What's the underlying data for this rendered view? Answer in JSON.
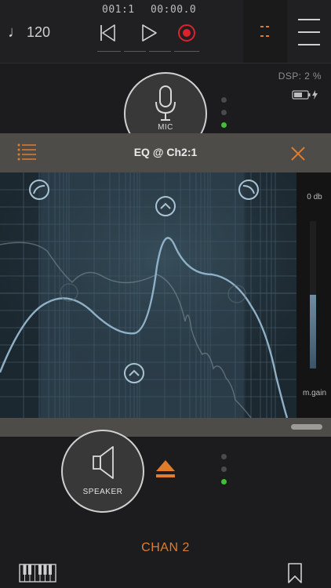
{
  "transport": {
    "tempo_symbol": "♩",
    "tempo": "120",
    "position": "001:1",
    "time": "00:00.0",
    "icons": [
      "skip-back-icon",
      "play-icon",
      "record-icon",
      "orange-dashes-icon",
      "menu-icon"
    ],
    "accent_color": "#e07c2c",
    "record_color": "#e0202a"
  },
  "channel_top": {
    "dsp": "DSP: 2 %",
    "input_label": "MIC",
    "battery_icon": "battery-charging-icon"
  },
  "eq": {
    "title": "EQ @ Ch2:1",
    "db_label": "0 db",
    "gain_label": "m.gain",
    "gain_level_fraction": 0.5,
    "handle_icons": [
      "low-shelf-handle-icon",
      "peak-handle-icon",
      "high-shelf-handle-icon",
      "peak-handle-icon"
    ]
  },
  "channel_bottom": {
    "output_label": "SPEAKER",
    "channel_name": "CHAN 2",
    "led_active_color": "#3ec234"
  }
}
